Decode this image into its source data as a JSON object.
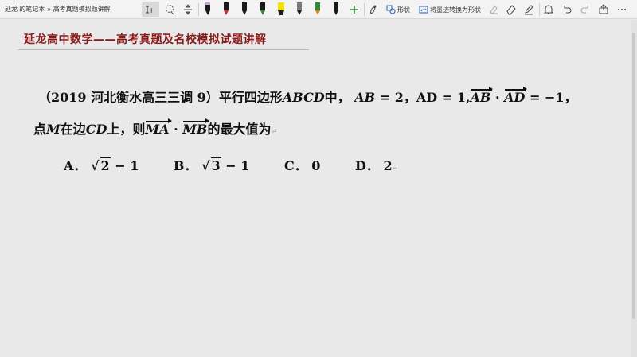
{
  "toolbar": {
    "breadcrumb_owner": "延龙 的笔记本",
    "breadcrumb_sep": "»",
    "breadcrumb_page": "高考真题模拟题讲解",
    "shape_label": "形状",
    "ink_to_shape_label": "将墨迹转换为形状",
    "colors": {
      "pen_black": "#1a1a1a",
      "pen_red": "#d42a2a",
      "highlighter_yellow": "#f2e200",
      "pen_green": "#2e8b2e",
      "pen_orange": "#e07b1a",
      "pen_gray": "#7a7a7a"
    }
  },
  "heading": "延龙高中数学——高考真题及名校模拟试题讲解",
  "question": {
    "source": "（2019 河北衡水高三三调 9）",
    "text1": "平行四边形",
    "shape": "ABCD",
    "text2": "中，",
    "ab": "AB",
    "eq_ab": " = 2，AD = 1,",
    "vec_ab": "AB",
    "dot": " · ",
    "vec_ad": "AD",
    "eq_dot": " = −1，",
    "line2_a": "点",
    "point": "M",
    "line2_b": "在边",
    "edge": "CD",
    "line2_c": "上，则",
    "vec_ma": "MA",
    "vec_mb": "MB",
    "line2_d": "的最大值为",
    "para_mark": "↵"
  },
  "options": {
    "a_label": "A．",
    "a_rad": "2",
    "a_rest": " − 1",
    "b_label": "B．",
    "b_rad": "3",
    "b_rest": " − 1",
    "c_label": "C．",
    "c_val": "0",
    "d_label": "D．",
    "d_val": "2"
  }
}
